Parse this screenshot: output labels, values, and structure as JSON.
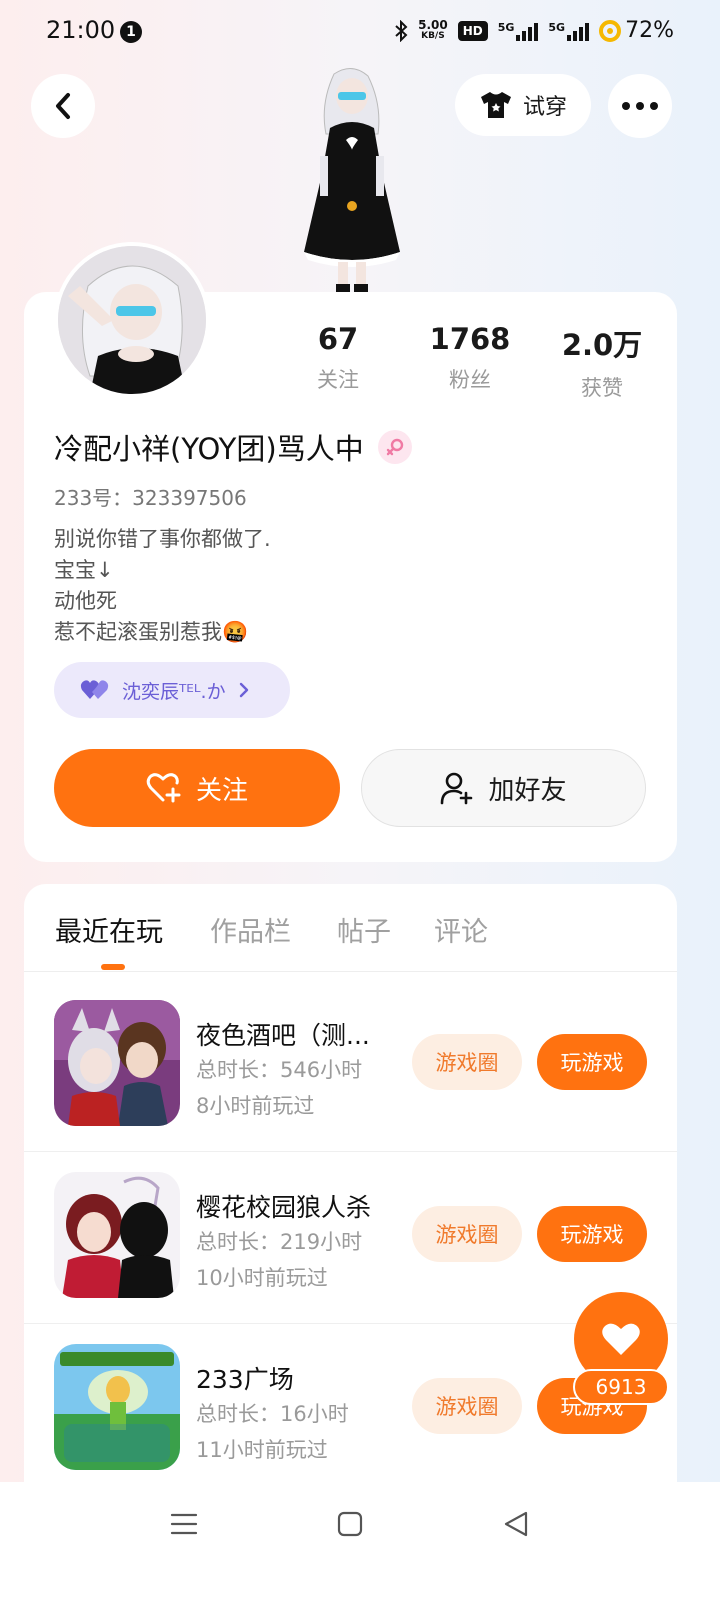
{
  "status_bar": {
    "time": "21:00",
    "notification_count": "1",
    "net_speed_value": "5.00",
    "net_speed_unit": "KB/S",
    "hd_label": "HD",
    "signal1_label": "5G",
    "signal2_label": "5G",
    "battery": "72%"
  },
  "top_nav": {
    "try_on_label": "试穿"
  },
  "profile": {
    "stats": [
      {
        "value": "67",
        "label": "关注"
      },
      {
        "value": "1768",
        "label": "粉丝"
      },
      {
        "value": "2.0万",
        "label": "获赞"
      }
    ],
    "name": "冷配小祥(YOY团)骂人中",
    "gender": "female",
    "uid": "233号：323397506",
    "bio": [
      "别说你错了事你都做了.",
      "宝宝↓",
      "动他死",
      "惹不起滚蛋别惹我🤬"
    ],
    "pill_label": "沈奕辰ᵀᴱᴸ.か",
    "follow_label": "关注",
    "add_friend_label": "加好友"
  },
  "tabs": [
    "最近在玩",
    "作品栏",
    "帖子",
    "评论"
  ],
  "games": [
    {
      "title": "夜色酒吧（测...",
      "duration": "总时长：546小时",
      "last_played": "8小时前玩过",
      "circle_label": "游戏圈",
      "play_label": "玩游戏"
    },
    {
      "title": "樱花校园狼人杀",
      "duration": "总时长：219小时",
      "last_played": "10小时前玩过",
      "circle_label": "游戏圈",
      "play_label": "玩游戏"
    },
    {
      "title": "233广场",
      "duration": "总时长：16小时",
      "last_played": "11小时前玩过",
      "circle_label": "游戏圈",
      "play_label": "玩游戏"
    }
  ],
  "like_fab": {
    "count": "6913"
  },
  "colors": {
    "accent": "#ff7210",
    "accent_soft": "#fdeee2",
    "pill_bg": "#ece9fb",
    "pill_text": "#6b5fd6"
  }
}
